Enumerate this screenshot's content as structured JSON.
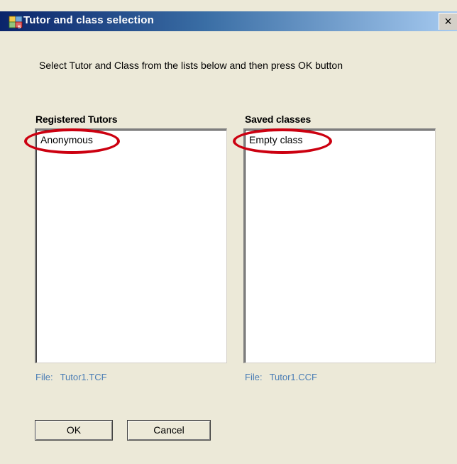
{
  "window": {
    "title": "Tutor and class selection",
    "close_glyph": "×"
  },
  "instructions": "Select Tutor and Class from the lists below and then press OK button",
  "tutors": {
    "heading": "Registered Tutors",
    "items": [
      "Anonymous"
    ],
    "file_prefix": "File:",
    "file_name": "Tutor1.TCF"
  },
  "classes": {
    "heading": "Saved classes",
    "items": [
      "Empty class"
    ],
    "file_prefix": "File:",
    "file_name": "Tutor1.CCF"
  },
  "buttons": {
    "ok": "OK",
    "cancel": "Cancel"
  },
  "colors": {
    "highlight_ring": "#cc0010",
    "file_label": "#4a7db5",
    "title_bar": "#0a246a"
  }
}
